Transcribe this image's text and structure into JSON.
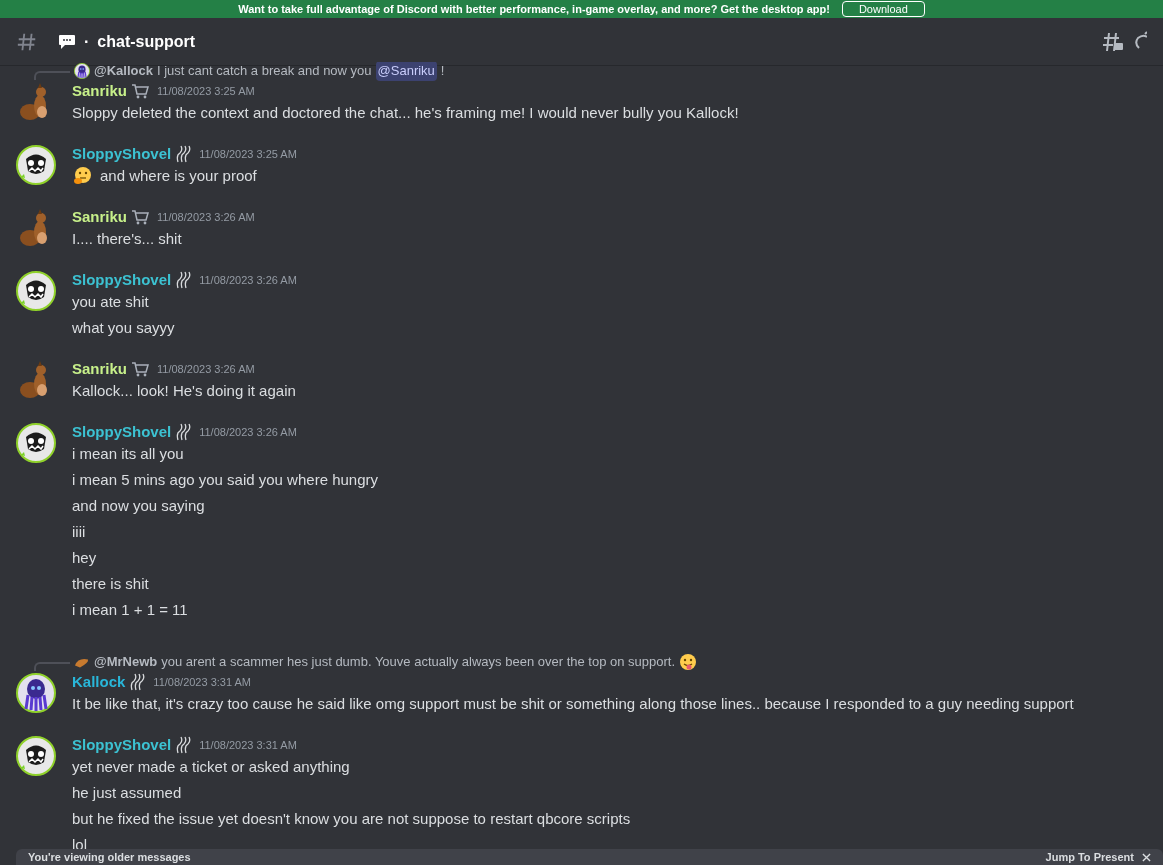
{
  "banner": {
    "text": "Want to take full advantage of Discord with better performance, in-game overlay, and more? Get the desktop app!",
    "button": "Download"
  },
  "channel": {
    "separator": "·",
    "name": "chat-support"
  },
  "messages": [
    {
      "author": "Sanriku",
      "color": "#c7f08a",
      "avatar": {
        "kind": "squirrel"
      },
      "badge": {
        "kind": "cart"
      },
      "time": "11/08/2023 3:25 AM",
      "reply": {
        "avatar": {
          "kind": "squid"
        },
        "author": "@Kallock",
        "text": "I just cant catch a break and now you",
        "mention": "@Sanriku",
        "tail": "!",
        "trailing_emoji": false
      },
      "lines": [
        {
          "text": "Sloppy deleted the context and doctored the chat... he's framing me! I would never bully you Kallock!",
          "leading_emoji": false
        }
      ]
    },
    {
      "author": "SloppyShovel",
      "color": "#3cc2d2",
      "avatar": {
        "kind": "skull"
      },
      "badge": {
        "kind": "waves"
      },
      "time": "11/08/2023 3:25 AM",
      "lines": [
        {
          "text": "and where is your proof",
          "leading_emoji": true
        }
      ]
    },
    {
      "author": "Sanriku",
      "color": "#c7f08a",
      "avatar": {
        "kind": "squirrel"
      },
      "badge": {
        "kind": "cart"
      },
      "time": "11/08/2023 3:26 AM",
      "lines": [
        {
          "text": "I.... there's... shit",
          "leading_emoji": false
        }
      ]
    },
    {
      "author": "SloppyShovel",
      "color": "#3cc2d2",
      "avatar": {
        "kind": "skull"
      },
      "badge": {
        "kind": "waves"
      },
      "time": "11/08/2023 3:26 AM",
      "lines": [
        {
          "text": "you ate shit",
          "leading_emoji": false
        },
        {
          "text": "what you sayyy",
          "leading_emoji": false
        }
      ]
    },
    {
      "author": "Sanriku",
      "color": "#c7f08a",
      "avatar": {
        "kind": "squirrel"
      },
      "badge": {
        "kind": "cart"
      },
      "time": "11/08/2023 3:26 AM",
      "lines": [
        {
          "text": "Kallock... look! He's doing it again",
          "leading_emoji": false
        }
      ]
    },
    {
      "author": "SloppyShovel",
      "color": "#3cc2d2",
      "avatar": {
        "kind": "skull"
      },
      "badge": {
        "kind": "waves"
      },
      "time": "11/08/2023 3:26 AM",
      "lines": [
        {
          "text": "i mean its all you",
          "leading_emoji": false
        },
        {
          "text": "i mean 5 mins ago you said you where hungry",
          "leading_emoji": false
        },
        {
          "text": "and now you saying",
          "leading_emoji": false
        },
        {
          "text": "iiii",
          "leading_emoji": false
        },
        {
          "text": "hey",
          "leading_emoji": false
        },
        {
          "text": "there is shit",
          "leading_emoji": false
        },
        {
          "text": "i mean 1  + 1 = 11",
          "leading_emoji": false
        }
      ]
    },
    {
      "author": "Kallock",
      "color": "#29b6d9",
      "avatar": {
        "kind": "squid"
      },
      "badge": {
        "kind": "waves"
      },
      "time": "11/08/2023 3:31 AM",
      "reply": {
        "avatar": {
          "kind": "bread"
        },
        "author": "@MrNewb",
        "text": "you arent a scammer hes just dumb. Youve actually always been over the top on support.",
        "trailing_emoji": true
      },
      "lines": [
        {
          "text": "It be like that, it's crazy too cause he said like omg support must be shit or something along those lines.. because I responded to a guy needing support",
          "leading_emoji": false
        }
      ]
    },
    {
      "author": "SloppyShovel",
      "color": "#3cc2d2",
      "avatar": {
        "kind": "skull"
      },
      "badge": {
        "kind": "waves"
      },
      "time": "11/08/2023 3:31 AM",
      "lines": [
        {
          "text": "yet never made a ticket or asked anything",
          "leading_emoji": false
        },
        {
          "text": "he just assumed",
          "leading_emoji": false
        },
        {
          "text": "but he fixed the issue yet doesn't know you are not suppose to restart qbcore scripts",
          "leading_emoji": false
        },
        {
          "text": "lol",
          "leading_emoji": false
        }
      ]
    }
  ],
  "notice": {
    "text": "You're viewing older messages",
    "action": "Jump To Present"
  }
}
